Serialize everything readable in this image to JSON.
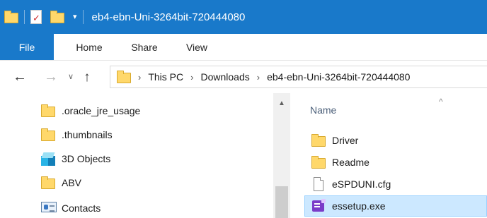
{
  "window": {
    "title": "eb4-ebn-Uni-3264bit-720444080",
    "accent_color": "#1979ca"
  },
  "quick_access": {
    "icons": [
      "folder-icon",
      "properties-icon",
      "new-folder-icon",
      "customize-dropdown-icon"
    ],
    "dropdown_glyph": "▾"
  },
  "ribbon": {
    "tabs": [
      {
        "label": "File"
      },
      {
        "label": "Home"
      },
      {
        "label": "Share"
      },
      {
        "label": "View"
      }
    ]
  },
  "navigation": {
    "back_glyph": "←",
    "forward_glyph": "→",
    "recent_glyph": "∨",
    "up_glyph": "↑"
  },
  "address_bar": {
    "separator": "›",
    "crumbs": [
      "This PC",
      "Downloads",
      "eb4-ebn-Uni-3264bit-720444080"
    ]
  },
  "nav_pane": {
    "items": [
      {
        "label": ".oracle_jre_usage",
        "icon": "folder-icon"
      },
      {
        "label": ".thumbnails",
        "icon": "folder-icon"
      },
      {
        "label": "3D Objects",
        "icon": "3d-objects-icon"
      },
      {
        "label": "ABV",
        "icon": "folder-icon"
      },
      {
        "label": "Contacts",
        "icon": "contacts-icon"
      }
    ]
  },
  "content": {
    "column_header": "Name",
    "sort_glyph": "^",
    "files": [
      {
        "name": "Driver",
        "icon": "folder-icon"
      },
      {
        "name": "Readme",
        "icon": "folder-icon"
      },
      {
        "name": "eSPDUNI.cfg",
        "icon": "document-icon"
      },
      {
        "name": "essetup.exe",
        "icon": "exe-icon",
        "selected": true
      }
    ]
  }
}
